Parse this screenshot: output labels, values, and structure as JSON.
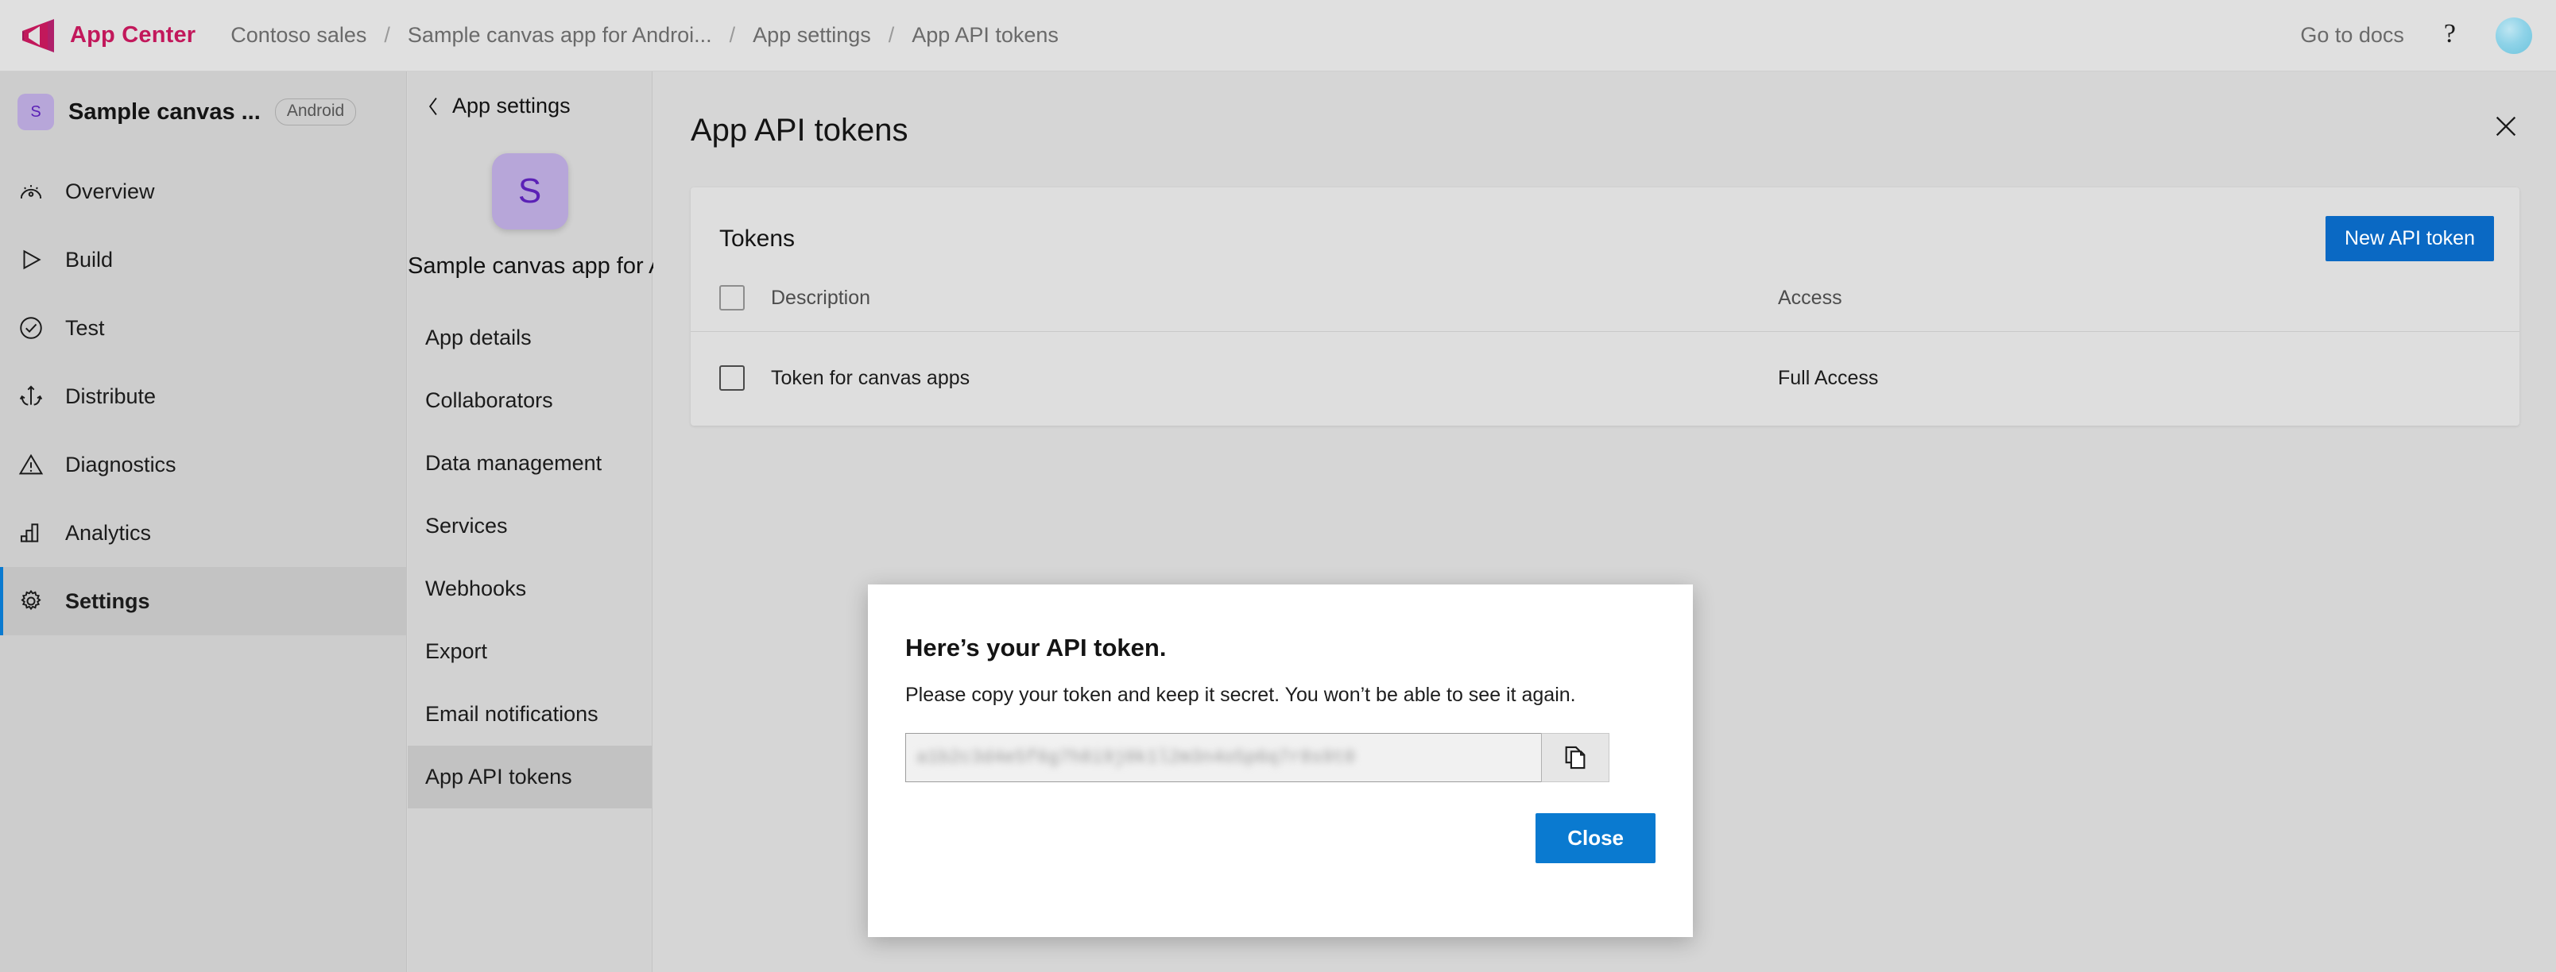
{
  "header": {
    "brand": "App Center",
    "logo_icon": "visual-studio-app-center-logo",
    "breadcrumbs": [
      {
        "label": "Contoso sales"
      },
      {
        "label": "Sample canvas app for Androi..."
      },
      {
        "label": "App settings"
      },
      {
        "label": "App API tokens"
      }
    ],
    "separator": "/",
    "go_to_docs": "Go to docs",
    "help_icon": "question-mark-icon",
    "avatar_icon": "user-avatar"
  },
  "rail": {
    "app_initial": "S",
    "app_title": "Sample canvas ...",
    "os_badge": "Android",
    "items": [
      {
        "label": "Overview",
        "icon": "gauge-icon",
        "selected": false
      },
      {
        "label": "Build",
        "icon": "play-icon",
        "selected": false
      },
      {
        "label": "Test",
        "icon": "check-circle-icon",
        "selected": false
      },
      {
        "label": "Distribute",
        "icon": "distribute-icon",
        "selected": false
      },
      {
        "label": "Diagnostics",
        "icon": "warning-triangle-icon",
        "selected": false
      },
      {
        "label": "Analytics",
        "icon": "bar-chart-icon",
        "selected": false
      },
      {
        "label": "Settings",
        "icon": "gear-icon",
        "selected": true
      }
    ],
    "accent_color": "#0a7ad0"
  },
  "settings_panel": {
    "back_label": "App settings",
    "back_icon": "chevron-left-icon",
    "app_initial": "S",
    "app_name": "Sample canvas app for Android OS",
    "items": [
      {
        "label": "App details",
        "selected": false
      },
      {
        "label": "Collaborators",
        "selected": false
      },
      {
        "label": "Data management",
        "selected": false
      },
      {
        "label": "Services",
        "selected": false
      },
      {
        "label": "Webhooks",
        "selected": false
      },
      {
        "label": "Export",
        "selected": false
      },
      {
        "label": "Email notifications",
        "selected": false
      },
      {
        "label": "App API tokens",
        "selected": true
      }
    ]
  },
  "main": {
    "title": "App API tokens",
    "close_icon": "close-x-icon",
    "card": {
      "title": "Tokens",
      "new_token_button": "New API token",
      "columns": [
        "Description",
        "Access"
      ],
      "rows": [
        {
          "description": "Token for canvas apps",
          "access": "Full Access",
          "checked": false
        }
      ]
    }
  },
  "modal": {
    "title": "Here’s your API token.",
    "subtitle": "Please copy your token and keep it secret. You won’t be able to see it again.",
    "token_value": "a1b2c3d4e5f6g7h8i9j0k1l2m3n4o5p6q7r8s9t0",
    "token_redacted": true,
    "copy_icon": "copy-pages-icon",
    "close_button": "Close"
  },
  "colors": {
    "brand": "#c2185b",
    "primary_button": "#0a69c4",
    "modal_button": "#0a7ad0",
    "app_tile": "#b7a6d9",
    "app_tile_text": "#5b21b6"
  }
}
